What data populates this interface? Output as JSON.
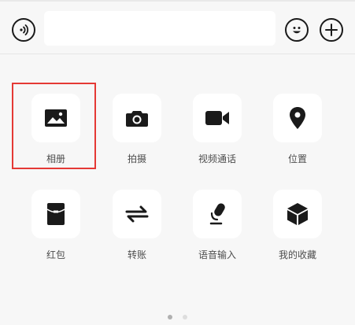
{
  "input_bar": {
    "text_value": "",
    "voice_icon": "voice-icon",
    "emoji_icon": "emoji-icon",
    "add_icon": "plus-icon"
  },
  "panel": {
    "items": [
      {
        "label": "相册",
        "icon": "photo-icon"
      },
      {
        "label": "拍摄",
        "icon": "camera-icon"
      },
      {
        "label": "视频通话",
        "icon": "video-icon"
      },
      {
        "label": "位置",
        "icon": "location-icon"
      },
      {
        "label": "红包",
        "icon": "red-packet-icon"
      },
      {
        "label": "转账",
        "icon": "transfer-icon"
      },
      {
        "label": "语音输入",
        "icon": "microphone-icon"
      },
      {
        "label": "我的收藏",
        "icon": "favorites-icon"
      }
    ],
    "page_indicator": {
      "pages": 2,
      "current": 1
    }
  },
  "colors": {
    "background": "#f7f7f7",
    "tile": "#ffffff",
    "icon": "#1a1a1a",
    "highlight": "#e53935",
    "dot_active": "#b0b0b0",
    "dot_inactive": "#dddddd"
  }
}
